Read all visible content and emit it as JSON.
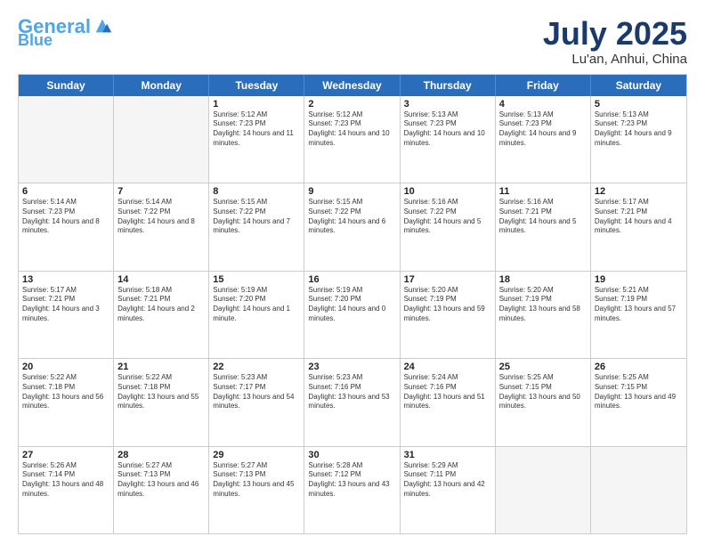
{
  "logo": {
    "part1": "General",
    "part2": "Blue"
  },
  "title": "July 2025",
  "location": "Lu'an, Anhui, China",
  "days_of_week": [
    "Sunday",
    "Monday",
    "Tuesday",
    "Wednesday",
    "Thursday",
    "Friday",
    "Saturday"
  ],
  "weeks": [
    [
      {
        "day": "",
        "info": ""
      },
      {
        "day": "",
        "info": ""
      },
      {
        "day": "1",
        "info": "Sunrise: 5:12 AM\nSunset: 7:23 PM\nDaylight: 14 hours and 11 minutes."
      },
      {
        "day": "2",
        "info": "Sunrise: 5:12 AM\nSunset: 7:23 PM\nDaylight: 14 hours and 10 minutes."
      },
      {
        "day": "3",
        "info": "Sunrise: 5:13 AM\nSunset: 7:23 PM\nDaylight: 14 hours and 10 minutes."
      },
      {
        "day": "4",
        "info": "Sunrise: 5:13 AM\nSunset: 7:23 PM\nDaylight: 14 hours and 9 minutes."
      },
      {
        "day": "5",
        "info": "Sunrise: 5:13 AM\nSunset: 7:23 PM\nDaylight: 14 hours and 9 minutes."
      }
    ],
    [
      {
        "day": "6",
        "info": "Sunrise: 5:14 AM\nSunset: 7:23 PM\nDaylight: 14 hours and 8 minutes."
      },
      {
        "day": "7",
        "info": "Sunrise: 5:14 AM\nSunset: 7:22 PM\nDaylight: 14 hours and 8 minutes."
      },
      {
        "day": "8",
        "info": "Sunrise: 5:15 AM\nSunset: 7:22 PM\nDaylight: 14 hours and 7 minutes."
      },
      {
        "day": "9",
        "info": "Sunrise: 5:15 AM\nSunset: 7:22 PM\nDaylight: 14 hours and 6 minutes."
      },
      {
        "day": "10",
        "info": "Sunrise: 5:16 AM\nSunset: 7:22 PM\nDaylight: 14 hours and 5 minutes."
      },
      {
        "day": "11",
        "info": "Sunrise: 5:16 AM\nSunset: 7:21 PM\nDaylight: 14 hours and 5 minutes."
      },
      {
        "day": "12",
        "info": "Sunrise: 5:17 AM\nSunset: 7:21 PM\nDaylight: 14 hours and 4 minutes."
      }
    ],
    [
      {
        "day": "13",
        "info": "Sunrise: 5:17 AM\nSunset: 7:21 PM\nDaylight: 14 hours and 3 minutes."
      },
      {
        "day": "14",
        "info": "Sunrise: 5:18 AM\nSunset: 7:21 PM\nDaylight: 14 hours and 2 minutes."
      },
      {
        "day": "15",
        "info": "Sunrise: 5:19 AM\nSunset: 7:20 PM\nDaylight: 14 hours and 1 minute."
      },
      {
        "day": "16",
        "info": "Sunrise: 5:19 AM\nSunset: 7:20 PM\nDaylight: 14 hours and 0 minutes."
      },
      {
        "day": "17",
        "info": "Sunrise: 5:20 AM\nSunset: 7:19 PM\nDaylight: 13 hours and 59 minutes."
      },
      {
        "day": "18",
        "info": "Sunrise: 5:20 AM\nSunset: 7:19 PM\nDaylight: 13 hours and 58 minutes."
      },
      {
        "day": "19",
        "info": "Sunrise: 5:21 AM\nSunset: 7:19 PM\nDaylight: 13 hours and 57 minutes."
      }
    ],
    [
      {
        "day": "20",
        "info": "Sunrise: 5:22 AM\nSunset: 7:18 PM\nDaylight: 13 hours and 56 minutes."
      },
      {
        "day": "21",
        "info": "Sunrise: 5:22 AM\nSunset: 7:18 PM\nDaylight: 13 hours and 55 minutes."
      },
      {
        "day": "22",
        "info": "Sunrise: 5:23 AM\nSunset: 7:17 PM\nDaylight: 13 hours and 54 minutes."
      },
      {
        "day": "23",
        "info": "Sunrise: 5:23 AM\nSunset: 7:16 PM\nDaylight: 13 hours and 53 minutes."
      },
      {
        "day": "24",
        "info": "Sunrise: 5:24 AM\nSunset: 7:16 PM\nDaylight: 13 hours and 51 minutes."
      },
      {
        "day": "25",
        "info": "Sunrise: 5:25 AM\nSunset: 7:15 PM\nDaylight: 13 hours and 50 minutes."
      },
      {
        "day": "26",
        "info": "Sunrise: 5:25 AM\nSunset: 7:15 PM\nDaylight: 13 hours and 49 minutes."
      }
    ],
    [
      {
        "day": "27",
        "info": "Sunrise: 5:26 AM\nSunset: 7:14 PM\nDaylight: 13 hours and 48 minutes."
      },
      {
        "day": "28",
        "info": "Sunrise: 5:27 AM\nSunset: 7:13 PM\nDaylight: 13 hours and 46 minutes."
      },
      {
        "day": "29",
        "info": "Sunrise: 5:27 AM\nSunset: 7:13 PM\nDaylight: 13 hours and 45 minutes."
      },
      {
        "day": "30",
        "info": "Sunrise: 5:28 AM\nSunset: 7:12 PM\nDaylight: 13 hours and 43 minutes."
      },
      {
        "day": "31",
        "info": "Sunrise: 5:29 AM\nSunset: 7:11 PM\nDaylight: 13 hours and 42 minutes."
      },
      {
        "day": "",
        "info": ""
      },
      {
        "day": "",
        "info": ""
      }
    ]
  ]
}
